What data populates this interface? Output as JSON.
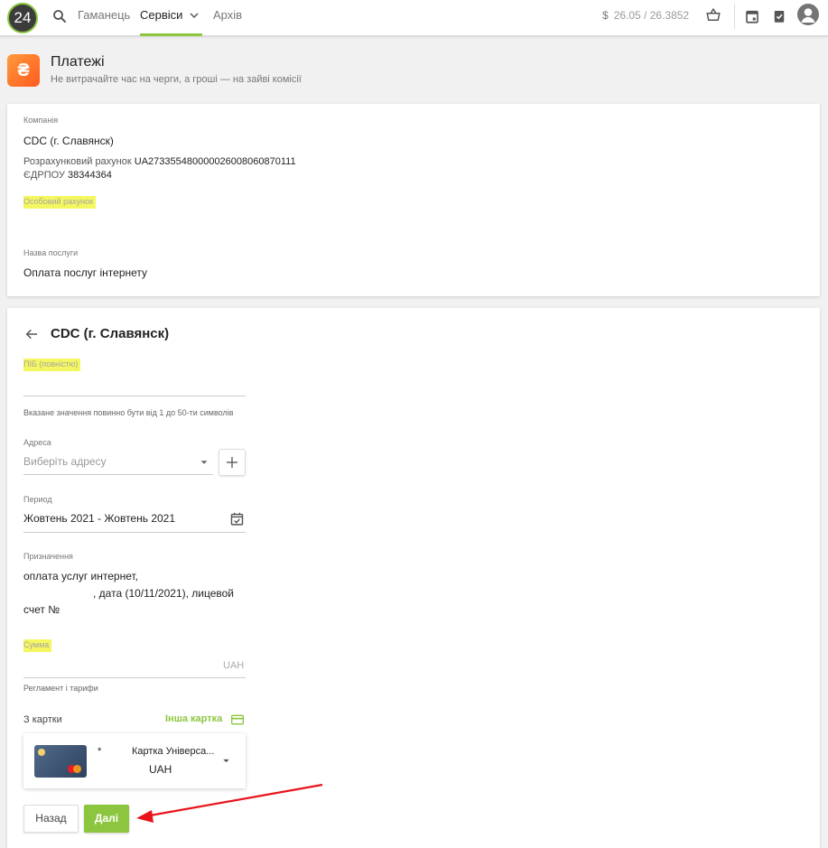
{
  "topbar": {
    "logo_text": "24",
    "nav": [
      "Гаманець",
      "Сервіси",
      "Архів"
    ],
    "rate_symbol": "$",
    "rate_text": "26.05 / 26.3852"
  },
  "header": {
    "title": "Платежі",
    "subtitle": "Не витрачайте час на черги, а гроші — на зайві комісії",
    "icon_glyph": "₴"
  },
  "company_card": {
    "company_label": "Компанія",
    "company_name": "CDC (г. Славянск)",
    "account_label": "Розрахунковий рахунок",
    "account_value": "UA273355480000026008060870111",
    "edrpou_label": "ЄДРПОУ",
    "edrpou_value": "38344364",
    "personal_account_label": "Особовий рахунок",
    "service_label": "Назва послуги",
    "service_value": "Оплата послуг інтернету"
  },
  "form": {
    "title": "CDC (г. Славянск)",
    "pib_label": "ПІБ (повністю)",
    "pib_value": "",
    "pib_hint": "Вказане значення повинно бути від 1 до 50-ти символів",
    "address_label": "Адреса",
    "address_placeholder": "Виберіть адресу",
    "period_label": "Период",
    "period_value": "Жовтень 2021 - Жовтень 2021",
    "purpose_label": "Призначення",
    "purpose_line1": "оплата услуг интернет,",
    "purpose_line2": ", дата (10/11/2021), лицевой",
    "purpose_line3": "счет №",
    "sum_label": "Сумма",
    "sum_currency": "UAH",
    "tariffs_link": "Регламент і тарифи",
    "from_card_label": "З картки",
    "other_card_link": "Інша картка",
    "card_name": "Картка Універса...",
    "card_mask": "*",
    "card_currency": "UAH",
    "back_button": "Назад",
    "next_button": "Далі"
  },
  "colors": {
    "accent_green": "#8cc63f",
    "highlight_yellow": "#f4f760",
    "annotation_red": "#e8141c",
    "service_orange": "#ff6a22"
  },
  "icons": [
    "search-icon",
    "chevron-down-icon",
    "basket-icon",
    "calendar-icon",
    "clipboard-check-icon",
    "avatar-icon",
    "arrow-left-icon",
    "plus-icon",
    "calendar-check-icon",
    "credit-card-icon"
  ]
}
